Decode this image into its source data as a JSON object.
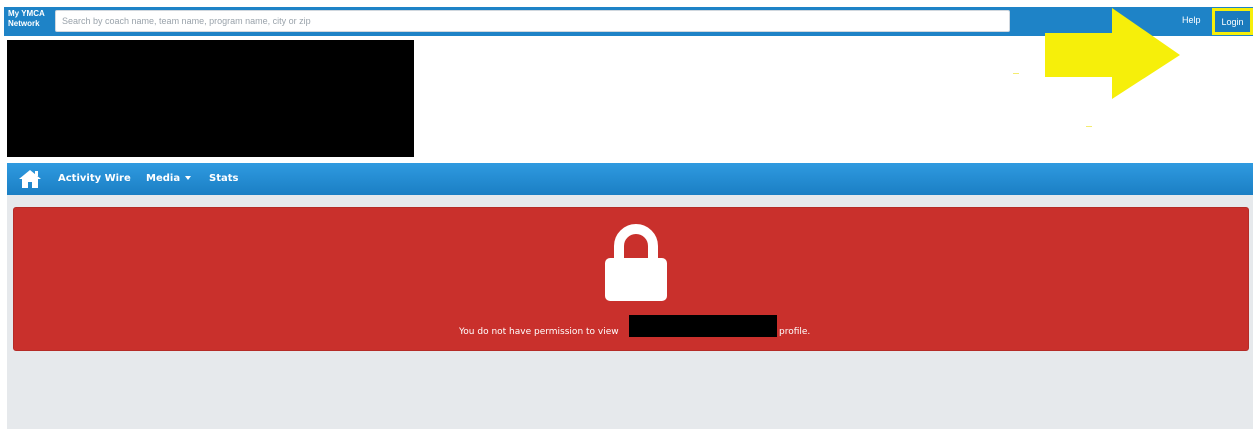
{
  "header": {
    "brand_line1": "My YMCA",
    "brand_line2": "Network",
    "search_placeholder": "Search by coach name, team name, program name, city or zip",
    "help_label": "Help",
    "login_label": "Login"
  },
  "nav": {
    "home_icon": "home-icon",
    "items": [
      {
        "label": "Activity Wire"
      },
      {
        "label": "Media"
      },
      {
        "label": "Stats"
      }
    ]
  },
  "alert": {
    "icon": "lock-icon",
    "message_start": "You do not have permission to view",
    "message_end": "profile."
  },
  "colors": {
    "topbar": "#1e83c7",
    "nav": "#1b7fc4",
    "alert": "#c9302c",
    "content_bg": "#e6e9ec",
    "annotation": "#f6ef0a"
  }
}
